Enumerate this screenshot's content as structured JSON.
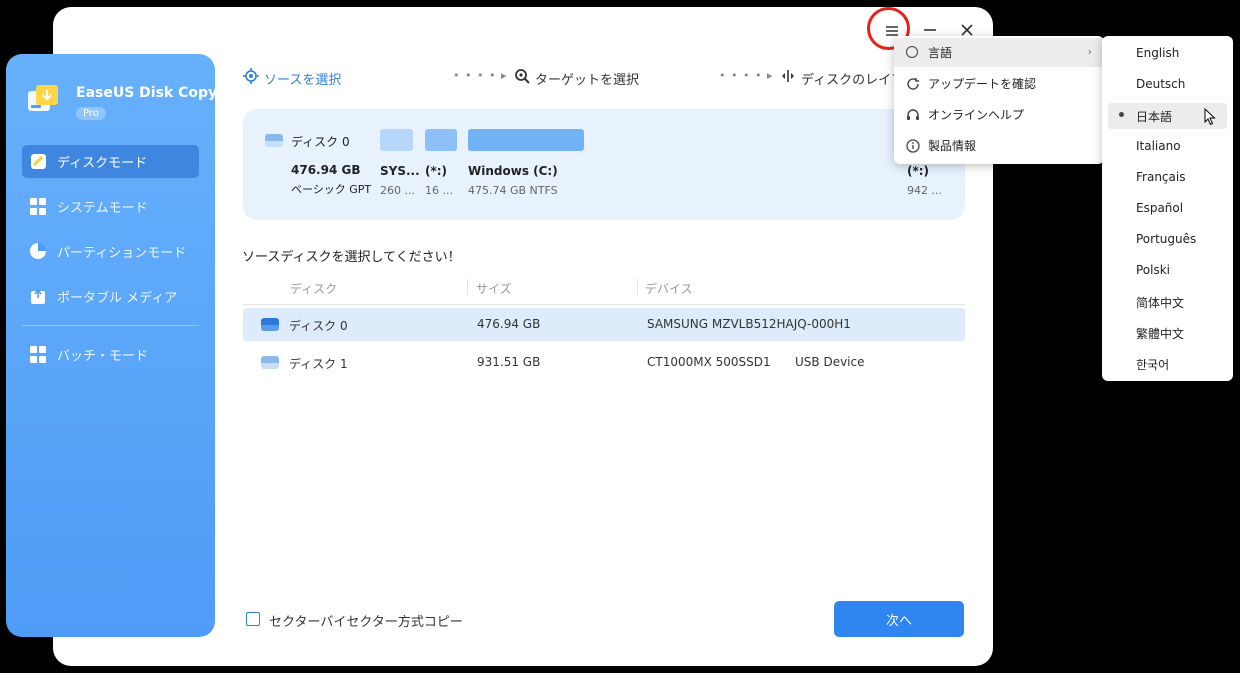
{
  "app": {
    "name": "EaseUS Disk Copy",
    "badge": "Pro"
  },
  "sidebar": {
    "items": [
      {
        "label": "ディスクモード",
        "icon": "disk-mode-icon",
        "active": true
      },
      {
        "label": "システムモード",
        "icon": "windows-icon",
        "active": false
      },
      {
        "label": "パーティションモード",
        "icon": "pie-chart-icon",
        "active": false
      },
      {
        "label": "ポータブル メディア",
        "icon": "portable-media-icon",
        "active": false
      },
      {
        "label": "バッチ・モード",
        "icon": "grid-icon",
        "active": false
      }
    ]
  },
  "steps": {
    "source": "ソースを選択",
    "target": "ターゲットを選択",
    "layout": "ディスクのレイアウト"
  },
  "disk_card": {
    "name": "ディスク 0",
    "size": "476.94 GB",
    "type": "ベーシック GPT",
    "partitions": [
      {
        "label": "SYS...",
        "size": "260 ..."
      },
      {
        "label": "(*:)",
        "size": "16 ..."
      },
      {
        "label": "Windows (C:)",
        "size": "475.74 GB NTFS"
      },
      {
        "label": "(*:)",
        "size": "942 ..."
      }
    ]
  },
  "table": {
    "title": "ソースディスクを選択してください！",
    "headers": [
      "ディスク",
      "サイズ",
      "デバイス"
    ],
    "rows": [
      {
        "disk": "ディスク 0",
        "size": "476.94 GB",
        "device": "SAMSUNG MZVLB512HAJQ-000H1",
        "extra": "",
        "selected": true
      },
      {
        "disk": "ディスク 1",
        "size": "931.51 GB",
        "device": "CT1000MX 500SSD1",
        "extra": "USB Device",
        "selected": false
      }
    ]
  },
  "footer": {
    "checkbox_label": "セクターバイセクター方式コピー",
    "next_button": "次へ"
  },
  "menu": {
    "items": [
      {
        "label": "言語",
        "icon": "globe-icon",
        "has_submenu": true
      },
      {
        "label": "アップデートを確認",
        "icon": "refresh-icon"
      },
      {
        "label": "オンラインヘルプ",
        "icon": "headset-icon"
      },
      {
        "label": "製品情報",
        "icon": "info-icon"
      }
    ]
  },
  "languages": {
    "selected": "日本語",
    "items": [
      "English",
      "Deutsch",
      "日本語",
      "Italiano",
      "Français",
      "Español",
      "Português",
      "Polski",
      "简体中文",
      "繁體中文",
      "한국어"
    ]
  },
  "colors": {
    "accent": "#2f86f1",
    "sidebar": "#5aa4f8",
    "highlight_circle": "#e5221c"
  }
}
